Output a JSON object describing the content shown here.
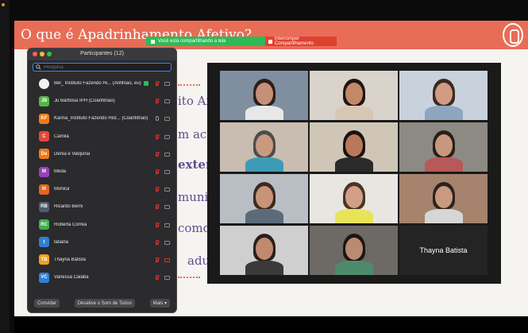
{
  "slide": {
    "title": "O que é Apadrinhamento Afetivo?",
    "fragments": [
      "ito Afe",
      "m aco",
      "exter",
      "muni",
      "como",
      "adu"
    ]
  },
  "sharing_bar": {
    "status_text": "Você está compartilhando a tela",
    "stop_text": "Interromper Compartilhamento"
  },
  "participants": {
    "title": "Participantes (12)",
    "search_placeholder": "Pesquisa",
    "list": [
      {
        "initials": "",
        "name": "Bel_ Instituto Fazendo Hi... (Anfitrião, eu)",
        "color": "#f2f2f2",
        "badge": true,
        "mic": "muted",
        "cam": "on"
      },
      {
        "initials": "JB",
        "name": "Ju Barbosa IPH (Coanfitrião)",
        "color": "#53b847",
        "badge": false,
        "mic": "muted",
        "cam": "on"
      },
      {
        "initials": "KF",
        "name": "Karina_Instituto Fazendo Hist... (Coanfitrião)",
        "color": "#f07a1a",
        "badge": false,
        "mic": "on",
        "cam": "on"
      },
      {
        "initials": "C",
        "name": "Camila",
        "color": "#e5483a",
        "badge": false,
        "mic": "muted",
        "cam": "on"
      },
      {
        "initials": "De",
        "name": "Denia e Valquiria",
        "color": "#f07a1a",
        "badge": false,
        "mic": "muted",
        "cam": "on"
      },
      {
        "initials": "M",
        "name": "Meda",
        "color": "#9b3fbd",
        "badge": false,
        "mic": "muted",
        "cam": "on"
      },
      {
        "initials": "M",
        "name": "Monica",
        "color": "#e8631f",
        "badge": false,
        "mic": "muted",
        "cam": "on"
      },
      {
        "initials": "RB",
        "name": "Ricardo Berni",
        "color": "#4f5b6e",
        "badge": false,
        "mic": "muted",
        "cam": "on"
      },
      {
        "initials": "RC",
        "name": "Roberta Corrêa",
        "color": "#3fae4e",
        "badge": false,
        "mic": "muted",
        "cam": "on"
      },
      {
        "initials": "t",
        "name": "tatiana",
        "color": "#2f7fd6",
        "badge": false,
        "mic": "muted",
        "cam": "on"
      },
      {
        "initials": "TB",
        "name": "Thayna Batista",
        "color": "#f0a21a",
        "badge": false,
        "mic": "muted",
        "cam": "off"
      },
      {
        "initials": "VC",
        "name": "Vanessa Calaba",
        "color": "#2f7fd6",
        "badge": false,
        "mic": "muted",
        "cam": "on"
      }
    ],
    "footer": {
      "invite": "Convidar",
      "mute_all": "Desative o Som de Todos",
      "more": "Mais ▾"
    }
  },
  "gallery": {
    "tiles": [
      {
        "label": "",
        "bg": "#7f8fa0",
        "skin": "#c49178",
        "hair": "#2c1f18",
        "shirt": "#e8e8e8",
        "active": false
      },
      {
        "label": "",
        "bg": "#d9d3cb",
        "skin": "#c4876a",
        "hair": "#1e1612",
        "shirt": "#d8c7b5",
        "active": false
      },
      {
        "label": "",
        "bg": "#c9d2dc",
        "skin": "#d19c83",
        "hair": "#3a2a20",
        "shirt": "#8fa6c0",
        "active": false
      },
      {
        "label": "",
        "bg": "#c8bdb0",
        "skin": "#c99a80",
        "hair": "#4c4c4c",
        "shirt": "#3d9bb5",
        "active": false
      },
      {
        "label": "",
        "bg": "#cfc6b8",
        "skin": "#b8795a",
        "hair": "#1a1210",
        "shirt": "#2a2a2a",
        "active": true
      },
      {
        "label": "",
        "bg": "#8d8a84",
        "skin": "#c8987e",
        "hair": "#2a1e18",
        "shirt": "#b85858",
        "active": false
      },
      {
        "label": "",
        "bg": "#b9bec4",
        "skin": "#c79479",
        "hair": "#3b2a1e",
        "shirt": "#5b6b7a",
        "active": false
      },
      {
        "label": "",
        "bg": "#e9e6e1",
        "skin": "#d2a085",
        "hair": "#4a3426",
        "shirt": "#e7e45a",
        "active": false
      },
      {
        "label": "",
        "bg": "#a5836c",
        "skin": "#c99a80",
        "hair": "#2b2420",
        "shirt": "#d6d6d6",
        "active": false
      },
      {
        "label": "",
        "bg": "#cfcfcf",
        "skin": "#c08a70",
        "hair": "#2a1e1a",
        "shirt": "#3a3a3a",
        "active": false
      },
      {
        "label": "",
        "bg": "#6d6a66",
        "skin": "#bb8a72",
        "hair": "#1c1614",
        "shirt": "#4c8a6b",
        "active": false
      },
      {
        "label": "Thayna Batista",
        "bg": "#242424",
        "skin": "",
        "hair": "",
        "shirt": "",
        "active": false
      }
    ]
  }
}
